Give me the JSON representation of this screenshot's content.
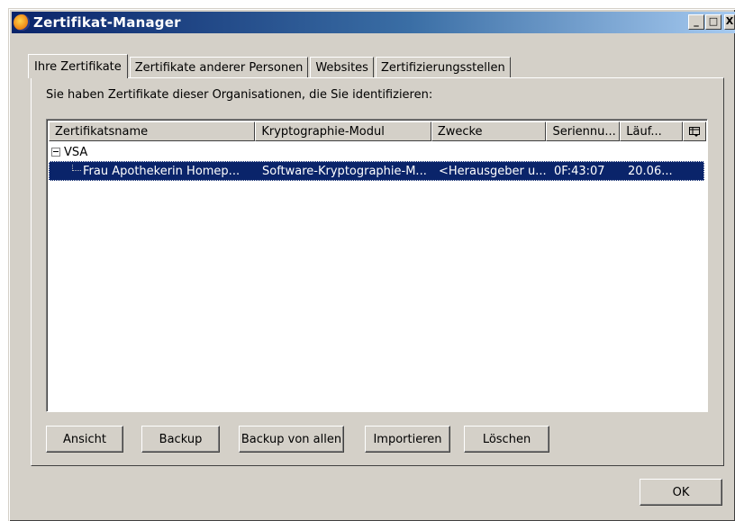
{
  "window": {
    "title": "Zertifikat-Manager",
    "controls": {
      "minimize": "_",
      "maximize": "□",
      "close": "X"
    }
  },
  "tabs": [
    {
      "label": "Ihre Zertifikate",
      "active": true
    },
    {
      "label": "Zertifikate anderer Personen",
      "active": false
    },
    {
      "label": "Websites",
      "active": false
    },
    {
      "label": "Zertifizierungsstellen",
      "active": false
    }
  ],
  "description": "Sie haben Zertifikate dieser Organisationen, die Sie identifizieren:",
  "table": {
    "columns": [
      "Zertifikatsname",
      "Kryptographie-Modul",
      "Zwecke",
      "Seriennu...",
      "Läuf..."
    ],
    "column_picker_icon": "column-picker-icon",
    "groups": [
      {
        "name": "VSA",
        "expanded": true,
        "rows": [
          {
            "cells": [
              "Frau Apothekerin Homep...",
              "Software-Kryptographie-M...",
              "<Herausgeber u...",
              "0F:43:07",
              "20.06..."
            ],
            "selected": true
          }
        ]
      }
    ]
  },
  "buttons": {
    "view": "Ansicht",
    "backup": "Backup",
    "backup_all": "Backup von allen",
    "import": "Importieren",
    "delete": "Löschen",
    "ok": "OK"
  }
}
